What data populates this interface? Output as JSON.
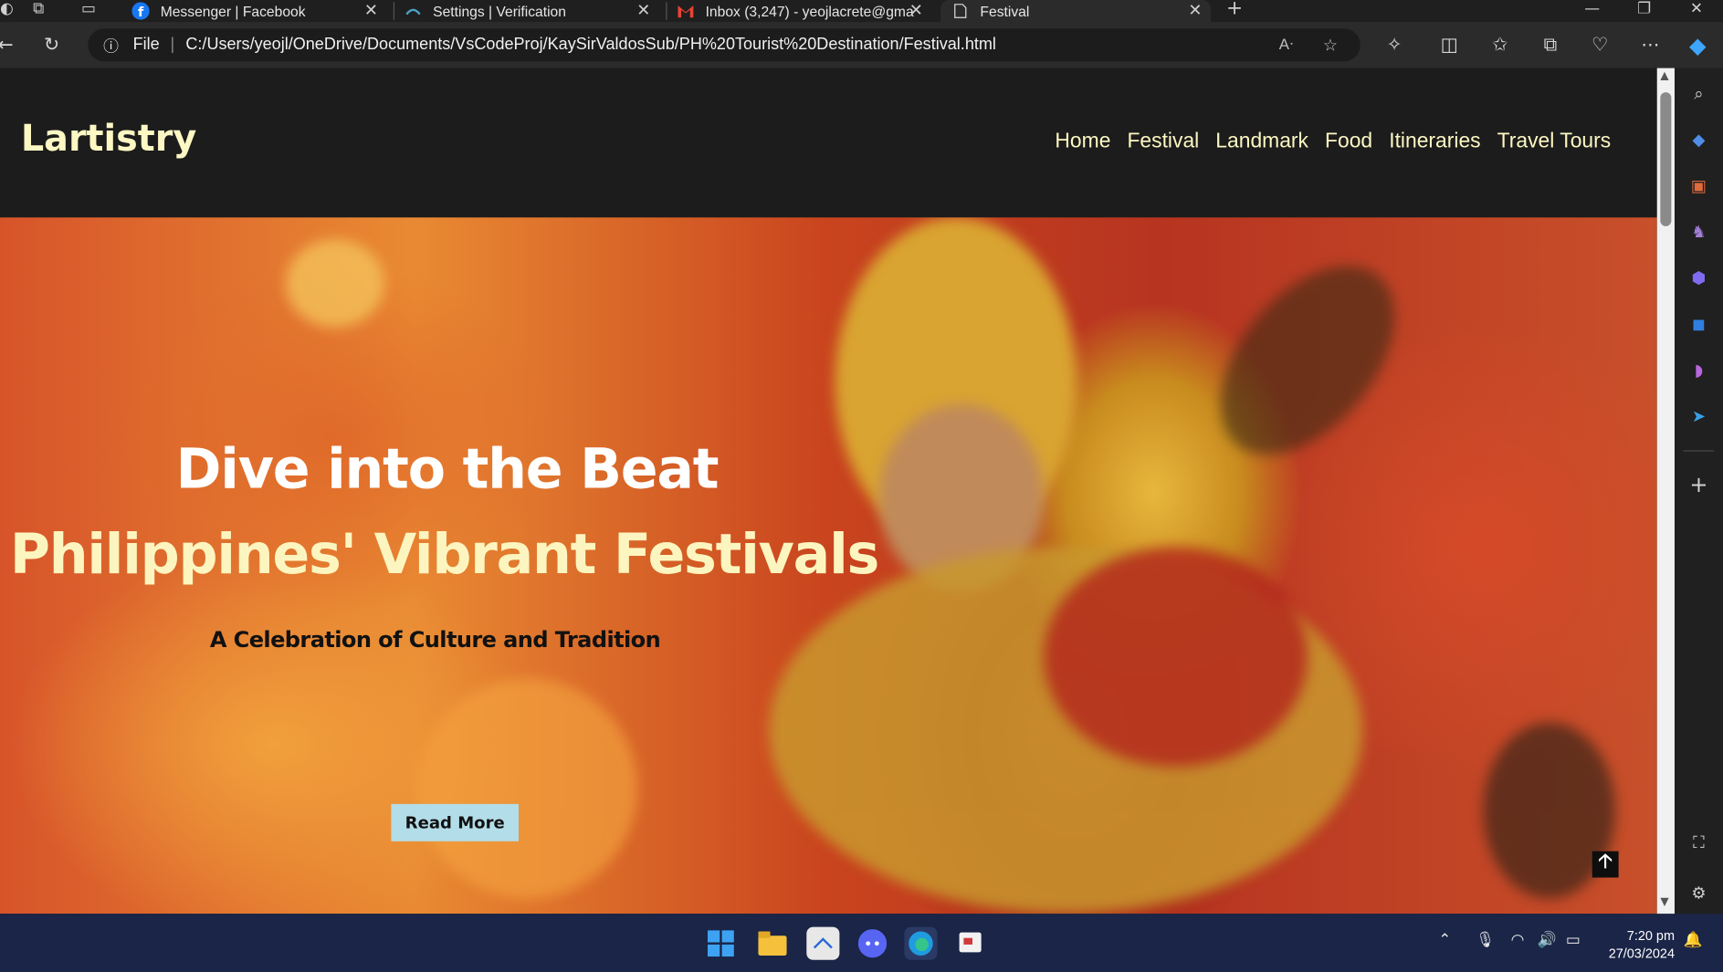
{
  "browser": {
    "tabs": [
      {
        "title": "Messenger | Facebook",
        "favicon": "facebook-icon"
      },
      {
        "title": "Settings | Verification",
        "favicon": "settings-cloud-icon"
      },
      {
        "title": "Inbox (3,247) - yeojlacrete@gma",
        "favicon": "gmail-icon"
      },
      {
        "title": "Festival",
        "favicon": "page-icon",
        "active": true
      }
    ],
    "new_tab_symbol": "+",
    "address": {
      "scheme_label": "File",
      "url": "C:/Users/yeojl/OneDrive/Documents/VsCodeProj/KaySirValdosSub/PH%20Tourist%20Destination/Festival.html"
    }
  },
  "site": {
    "logo": "Lartistry",
    "nav": [
      "Home",
      "Festival",
      "Landmark",
      "Food",
      "Itineraries",
      "Travel Tours"
    ]
  },
  "hero": {
    "line1": "Dive into the Beat",
    "line2": "Philippines' Vibrant Festivals",
    "subtitle": "A Celebration of Culture and Tradition",
    "button": "Read More",
    "scroll_top_symbol": "🡡"
  },
  "taskbar": {
    "time": "7:20 pm",
    "date": "27/03/2024"
  },
  "colors": {
    "accent_cream": "#fdf7c3",
    "header_bg": "#1c1c1c",
    "button_bg": "#b3dde8",
    "taskbar_bg": "#1a2547"
  }
}
